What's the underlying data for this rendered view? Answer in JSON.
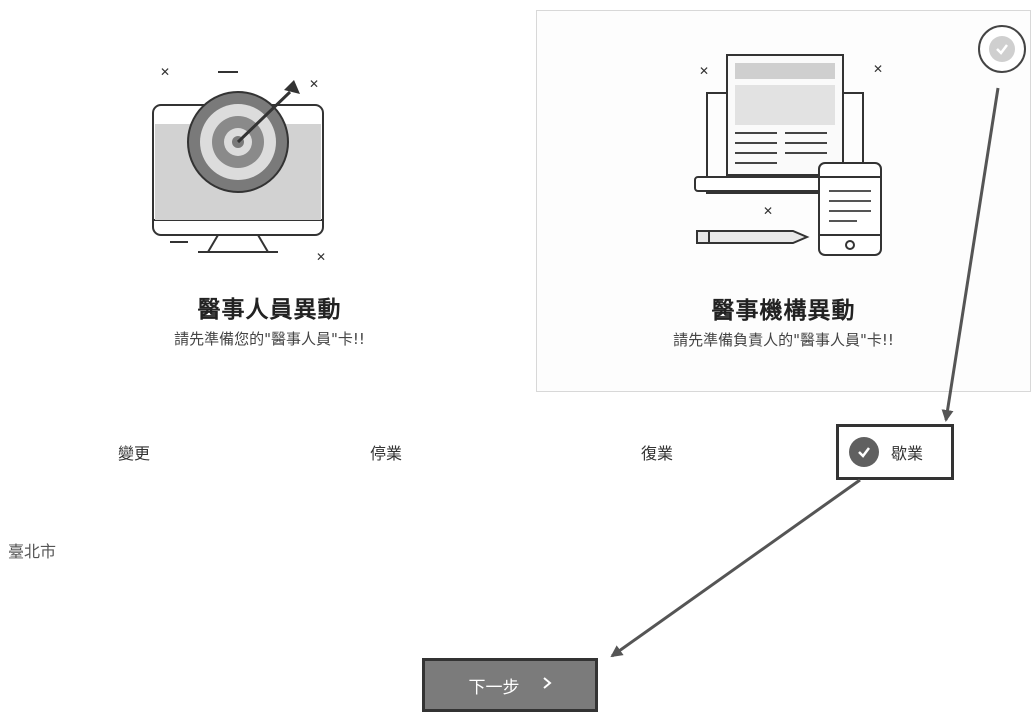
{
  "cards": [
    {
      "title": "醫事人員異動",
      "subtitle": "請先準備您的\"醫事人員\"卡!!",
      "icon": "target-monitor-icon"
    },
    {
      "title": "醫事機構異動",
      "subtitle": "請先準備負責人的\"醫事人員\"卡!!",
      "icon": "documents-devices-icon",
      "selected": true
    }
  ],
  "options": [
    {
      "label": "變更",
      "selected": false
    },
    {
      "label": "停業",
      "selected": false
    },
    {
      "label": "復業",
      "selected": false
    },
    {
      "label": "歇業",
      "selected": true
    }
  ],
  "city": "臺北市",
  "next_button": {
    "label": "下一步",
    "icon": "chevron-right-icon"
  },
  "colors": {
    "selected_check": "#606060",
    "button_bg": "#7b7b7b",
    "annotation_arrow": "#555555"
  }
}
